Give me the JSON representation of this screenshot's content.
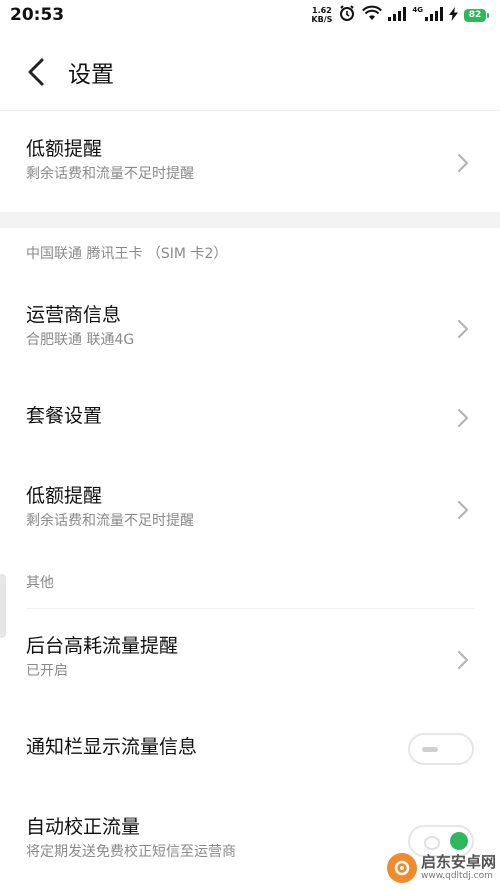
{
  "status_bar": {
    "time": "20:53",
    "net_speed_value": "1.62",
    "net_speed_unit": "KB/S",
    "network_type": "4G",
    "battery": "82"
  },
  "header": {
    "title": "设置"
  },
  "rows": {
    "low_balance_1": {
      "title": "低额提醒",
      "subtitle": "剩余话费和流量不足时提醒"
    },
    "carrier_info": {
      "title": "运营商信息",
      "subtitle": "合肥联通 联通4G"
    },
    "plan_settings": {
      "title": "套餐设置"
    },
    "low_balance_2": {
      "title": "低额提醒",
      "subtitle": "剩余话费和流量不足时提醒"
    },
    "background_usage": {
      "title": "后台高耗流量提醒",
      "subtitle": "已开启"
    },
    "notification_traffic": {
      "title": "通知栏显示流量信息",
      "enabled": false
    },
    "auto_calibrate": {
      "title": "自动校正流量",
      "subtitle": "将定期发送免费校正短信至运营商",
      "enabled": true
    }
  },
  "sections": {
    "sim2": "中国联通 腾讯王卡 （SIM 卡2）",
    "other": "其他"
  },
  "watermark": {
    "name": "启东安卓网",
    "url": "www.qdltdj.com"
  },
  "colors": {
    "accent_green": "#2eb85c",
    "subtitle_gray": "#8a8a8a",
    "band_gray": "#f3f3f3"
  }
}
